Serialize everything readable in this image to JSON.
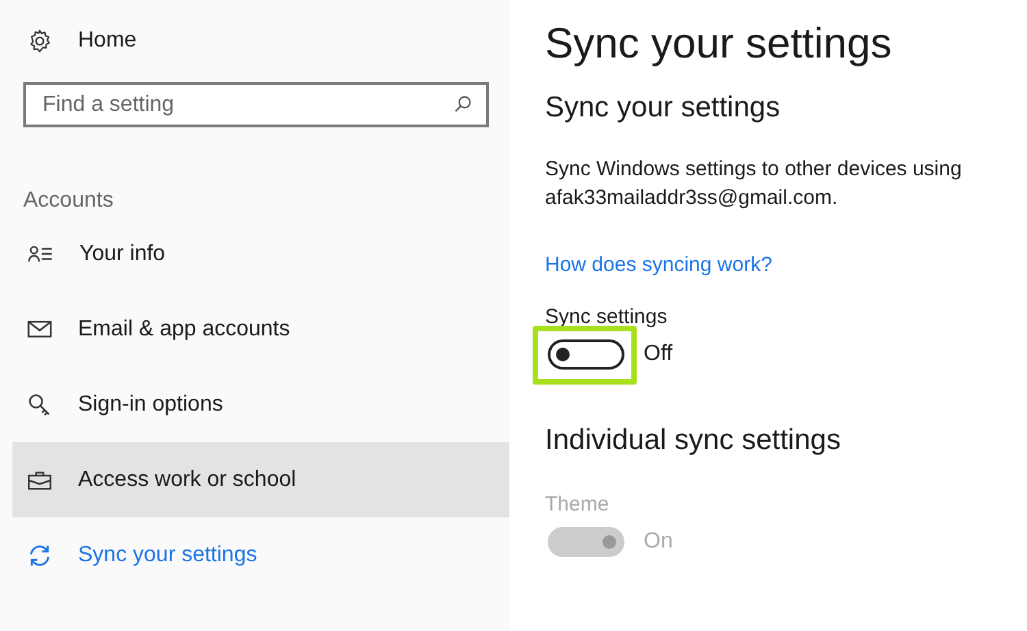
{
  "sidebar": {
    "home": {
      "label": "Home"
    },
    "search": {
      "placeholder": "Find a setting"
    },
    "section": "Accounts",
    "items": [
      {
        "label": "Your info",
        "kind": "person",
        "selected": false,
        "hovered": false
      },
      {
        "label": "Email & app accounts",
        "kind": "mail",
        "selected": false,
        "hovered": false
      },
      {
        "label": "Sign-in options",
        "kind": "key",
        "selected": false,
        "hovered": false
      },
      {
        "label": "Access work or school",
        "kind": "briefcase",
        "selected": false,
        "hovered": true
      },
      {
        "label": "Sync your settings",
        "kind": "sync",
        "selected": true,
        "hovered": false
      }
    ]
  },
  "main": {
    "title": "Sync your settings",
    "subtitle": "Sync your settings",
    "description": "Sync Windows settings to other devices using afak33mailaddr3ss@gmail.com.",
    "link": "How does syncing work?",
    "sync": {
      "label": "Sync settings",
      "on": false,
      "state_text": "Off",
      "highlighted": true
    },
    "individual_heading": "Individual sync settings",
    "individual": [
      {
        "label": "Theme",
        "on": true,
        "disabled": true,
        "state_text": "On"
      }
    ]
  }
}
